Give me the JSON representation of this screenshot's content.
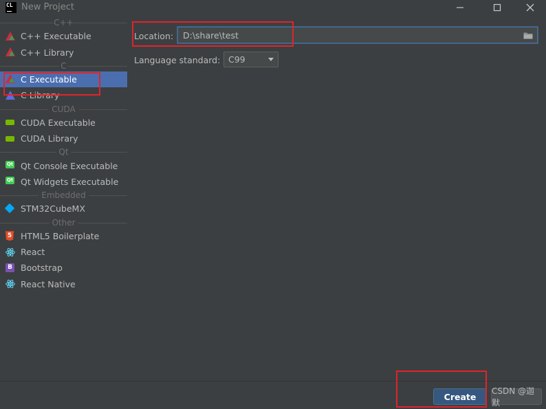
{
  "window": {
    "app_icon_text": "CL",
    "title": "New Project",
    "controls": {
      "minimize_icon": "minimize-icon",
      "maximize_icon": "maximize-icon",
      "close_icon": "close-icon"
    }
  },
  "sidebar": {
    "groups": [
      {
        "label": "C++",
        "items": [
          {
            "label": "C++ Executable",
            "icon": "clion-triangle-icon"
          },
          {
            "label": "C++ Library",
            "icon": "clion-triangle-icon"
          }
        ]
      },
      {
        "label": "C",
        "items": [
          {
            "label": "C Executable",
            "icon": "clion-triangle-icon",
            "selected": true
          },
          {
            "label": "C Library",
            "icon": "clion-triangle-icon"
          }
        ]
      },
      {
        "label": "CUDA",
        "items": [
          {
            "label": "CUDA Executable",
            "icon": "nvidia-icon"
          },
          {
            "label": "CUDA Library",
            "icon": "nvidia-icon"
          }
        ]
      },
      {
        "label": "Qt",
        "items": [
          {
            "label": "Qt Console Executable",
            "icon": "qt-icon"
          },
          {
            "label": "Qt Widgets Executable",
            "icon": "qt-icon"
          }
        ]
      },
      {
        "label": "Embedded",
        "items": [
          {
            "label": "STM32CubeMX",
            "icon": "stm32-cube-icon"
          }
        ]
      },
      {
        "label": "Other",
        "items": [
          {
            "label": "HTML5 Boilerplate",
            "icon": "html5-icon"
          },
          {
            "label": "React",
            "icon": "react-icon"
          },
          {
            "label": "Bootstrap",
            "icon": "bootstrap-icon"
          },
          {
            "label": "React Native",
            "icon": "react-icon"
          }
        ]
      }
    ]
  },
  "form": {
    "location_label": "Location:",
    "location_value": "D:\\share\\test",
    "language_label": "Language standard:",
    "language_value": "C99"
  },
  "footer": {
    "create_label": "Create",
    "watermark": "CSDN @迦默"
  },
  "colors": {
    "background": "#3c3f41",
    "selection": "#4b6eaf",
    "primary_button": "#365880",
    "annotation_red": "#e0242b"
  }
}
